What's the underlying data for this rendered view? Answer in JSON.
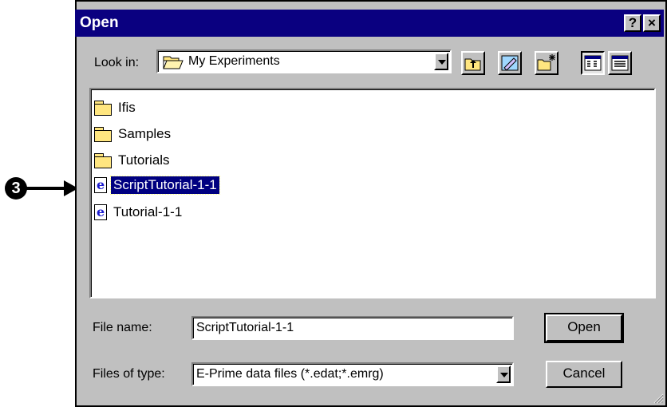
{
  "dialog": {
    "title": "Open",
    "help_glyph": "?",
    "close_glyph": "×"
  },
  "look_in": {
    "label": "Look in:",
    "value": "My Experiments",
    "icon": "folder-open-icon"
  },
  "toolbar": {
    "buttons": [
      {
        "name": "up-one-level-icon"
      },
      {
        "name": "desktop-icon"
      },
      {
        "name": "create-new-folder-icon"
      },
      {
        "name": "list-view-icon"
      },
      {
        "name": "details-view-icon"
      }
    ]
  },
  "files": [
    {
      "name": "Ifis",
      "type": "folder"
    },
    {
      "name": "Samples",
      "type": "folder"
    },
    {
      "name": "Tutorials",
      "type": "folder"
    },
    {
      "name": "ScriptTutorial-1-1",
      "type": "e-prime-file",
      "selected": true
    },
    {
      "name": "Tutorial-1-1",
      "type": "e-prime-file"
    }
  ],
  "file_name": {
    "label": "File name:",
    "value": "ScriptTutorial-1-1"
  },
  "file_type": {
    "label": "Files of type:",
    "value": "E-Prime data files (*.edat;*.emrg)"
  },
  "buttons": {
    "open": "Open",
    "cancel": "Cancel"
  },
  "annotation": {
    "number": "3"
  },
  "colors": {
    "title_bar": "#0a0080",
    "selection": "#000080",
    "face": "#c0c0c0"
  }
}
